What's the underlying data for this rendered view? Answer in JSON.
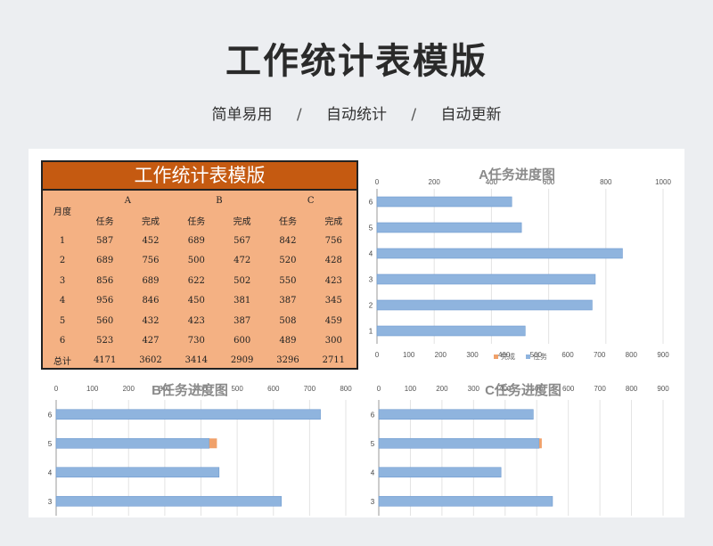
{
  "page": {
    "title": "工作统计表模版",
    "tags": [
      "简单易用",
      "自动统计",
      "自动更新"
    ],
    "separator": "/"
  },
  "table": {
    "title": "工作统计表模版",
    "month_label": "月度",
    "groups": [
      "A",
      "B",
      "C"
    ],
    "sub_headers": [
      "任务",
      "完成",
      "任务",
      "完成",
      "任务",
      "完成"
    ],
    "rows": [
      {
        "label": "1",
        "values": [
          "587",
          "452",
          "689",
          "567",
          "842",
          "756"
        ]
      },
      {
        "label": "2",
        "values": [
          "689",
          "756",
          "500",
          "472",
          "520",
          "428"
        ]
      },
      {
        "label": "3",
        "values": [
          "856",
          "689",
          "622",
          "502",
          "550",
          "423"
        ]
      },
      {
        "label": "4",
        "values": [
          "956",
          "846",
          "450",
          "381",
          "387",
          "345"
        ]
      },
      {
        "label": "5",
        "values": [
          "560",
          "432",
          "423",
          "387",
          "508",
          "459"
        ]
      },
      {
        "label": "6",
        "values": [
          "523",
          "427",
          "730",
          "600",
          "489",
          "300"
        ]
      }
    ],
    "total": {
      "label": "总计",
      "values": [
        "4171",
        "3602",
        "3414",
        "2909",
        "3296",
        "2711"
      ]
    }
  },
  "colors": {
    "task": "#8fb4de",
    "done": "#f0a16a",
    "header": "#c55a11",
    "table_bg": "#f4b183"
  },
  "chart_data": [
    {
      "type": "bar",
      "title": "A任务进度图",
      "categories": [
        "1",
        "2",
        "3",
        "4",
        "5",
        "6"
      ],
      "series": [
        {
          "name": "任务",
          "values": [
            518,
            752,
            763,
            858,
            505,
            471
          ]
        },
        {
          "name": "完成",
          "values": [
            0,
            751,
            0,
            0,
            0,
            0
          ]
        }
      ],
      "top_ticks": [
        "0",
        "200",
        "400",
        "600",
        "800",
        "1000"
      ],
      "bottom_ticks": [
        "0",
        "100",
        "200",
        "300",
        "400",
        "500",
        "600",
        "700",
        "800",
        "900"
      ],
      "legend": [
        "完成",
        "任务"
      ]
    },
    {
      "type": "bar",
      "title": "B任务进度图",
      "categories": [
        "3",
        "4",
        "5",
        "6"
      ],
      "series": [
        {
          "name": "任务",
          "values": [
            622,
            450,
            423,
            730
          ]
        },
        {
          "name": "完成",
          "values": [
            0,
            0,
            444,
            0
          ]
        }
      ],
      "top_ticks": [
        "0",
        "100",
        "200",
        "300",
        "400",
        "500",
        "600",
        "700",
        "800"
      ]
    },
    {
      "type": "bar",
      "title": "C任务进度图",
      "categories": [
        "3",
        "4",
        "5",
        "6"
      ],
      "series": [
        {
          "name": "任务",
          "values": [
            550,
            387,
            508,
            489
          ]
        },
        {
          "name": "完成",
          "values": [
            0,
            0,
            516,
            0
          ]
        }
      ],
      "top_ticks": [
        "0",
        "100",
        "200",
        "300",
        "400",
        "500",
        "600",
        "700",
        "800",
        "900"
      ]
    }
  ]
}
